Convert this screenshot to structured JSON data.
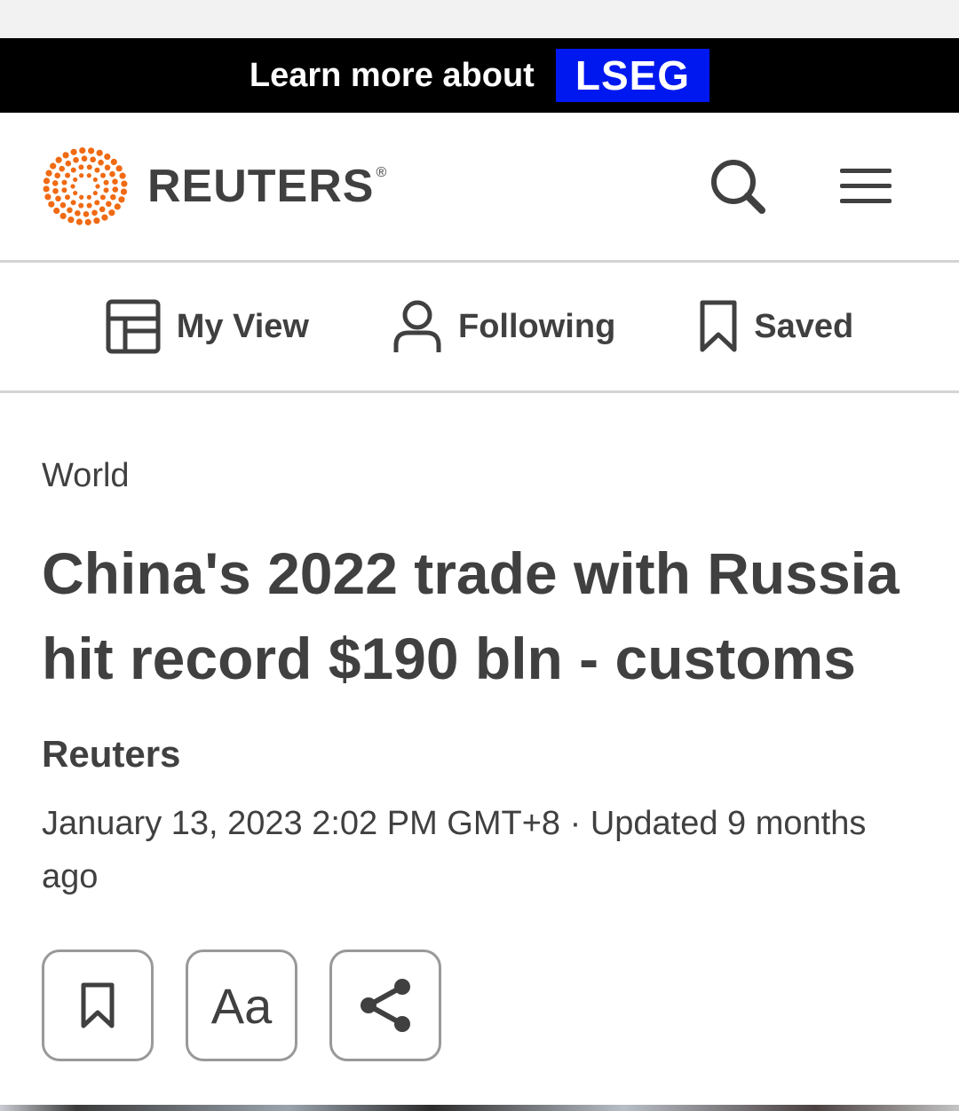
{
  "promo": {
    "text": "Learn more about",
    "badge": "LSEG",
    "badge_color": "#0018f0"
  },
  "header": {
    "logo_text": "REUTERS",
    "logo_mark": "®",
    "logo_color": "#f06a13",
    "search_icon": "search-icon",
    "menu_icon": "hamburger-menu-icon"
  },
  "nav": {
    "tabs": [
      {
        "label": "My View",
        "icon": "layout-icon"
      },
      {
        "label": "Following",
        "icon": "person-icon"
      },
      {
        "label": "Saved",
        "icon": "bookmark-icon"
      }
    ]
  },
  "article": {
    "section": "World",
    "headline": "China's 2022 trade with Russia hit record $190 bln - customs",
    "author": "Reuters",
    "dateline": "January 13, 2023 2:02 PM GMT+8 · Updated 9 months ago",
    "actions": {
      "save_icon": "bookmark-icon",
      "text_size_label": "Aa",
      "share_icon": "share-icon"
    }
  }
}
